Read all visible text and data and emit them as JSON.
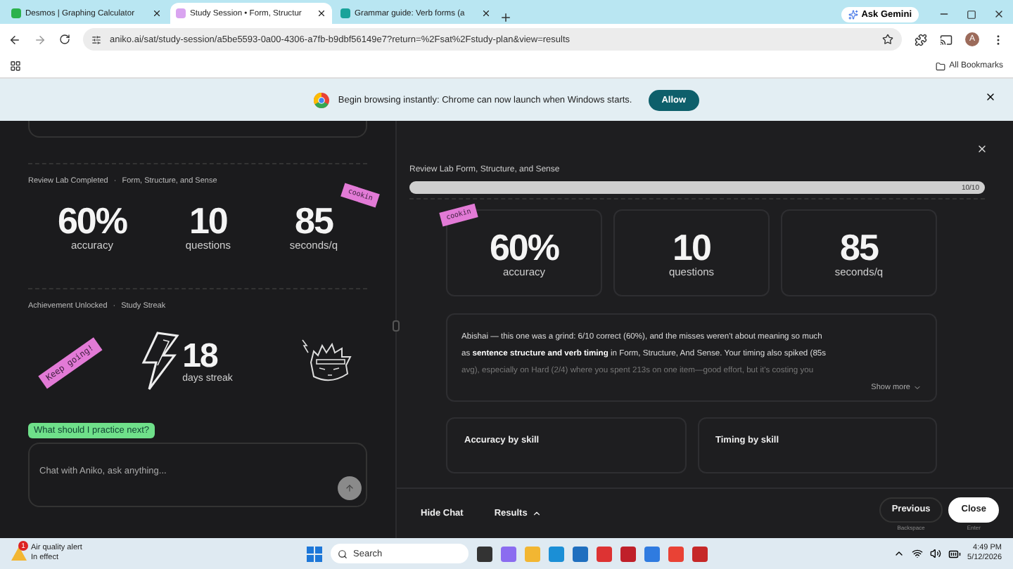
{
  "browser": {
    "tabs": [
      {
        "title": "Desmos | Graphing Calculator",
        "selected": false,
        "kind": "calc"
      },
      {
        "title": "Study Session • Form, Structur",
        "selected": true,
        "kind": "letter"
      },
      {
        "title": "Grammar guide: Verb forms (a",
        "selected": false,
        "kind": "leaf"
      }
    ],
    "ask_gemini": "Ask Gemini",
    "url": "aniko.ai/sat/study-session/a5be5593-0a00-4306-a7fb-b9dbf56149e7?return=%2Fsat%2Fstudy-plan&view=results",
    "avatar": "A",
    "bookmarks": "All Bookmarks",
    "infobar": {
      "message": "Begin browsing instantly: Chrome can now launch when Windows starts.",
      "button": "Allow"
    }
  },
  "left": {
    "lab": {
      "heading": "Review Lab Completed",
      "separator": "·",
      "topic": "Form, Structure, and Sense",
      "sticker": "cookin",
      "stats": [
        {
          "value": "60%",
          "label": "accuracy"
        },
        {
          "value": "10",
          "label": "questions"
        },
        {
          "value": "85",
          "label": "seconds/q"
        }
      ]
    },
    "achievement": {
      "heading": "Achievement Unlocked",
      "separator": "·",
      "topic": "Study Streak",
      "sticker": "Keep going!",
      "value": "18",
      "label": "days streak"
    },
    "suggestion": "What should I practice next?",
    "chat": {
      "placeholder": "Chat with Aniko, ask anything..."
    }
  },
  "right": {
    "title": "Review Lab Form, Structure, and Sense",
    "progress": {
      "level": 1,
      "reading": "10/10"
    },
    "sticker": "cookin",
    "stats": [
      {
        "value": "60%",
        "label": "accuracy"
      },
      {
        "value": "10",
        "label": "questions"
      },
      {
        "value": "85",
        "label": "seconds/q"
      }
    ],
    "summary": [
      "Abishai — this one was a grind: 6/10 correct (60%), and the misses weren't about meaning so much",
      "as **sentence structure and verb timing** in Form, Structure, And Sense. Your timing also spiked (85s",
      "avg), especially on Hard (2/4) where you spent 213s on one item—good effort, but it's costing you"
    ],
    "show_more": "Show more",
    "cards": [
      "Accuracy by skill",
      "Timing by skill"
    ],
    "footer": {
      "hide_chat": "Hide Chat",
      "results": "Results",
      "previous": "Previous",
      "previous_hint": "Backspace",
      "close": "Close",
      "close_hint": "Enter"
    }
  },
  "taskbar": {
    "alert_title": "Air quality alert",
    "alert_subtitle": "In effect",
    "alert_badge": "1",
    "search": "Search",
    "time": "4:49 PM",
    "date": "5/12/2026"
  }
}
